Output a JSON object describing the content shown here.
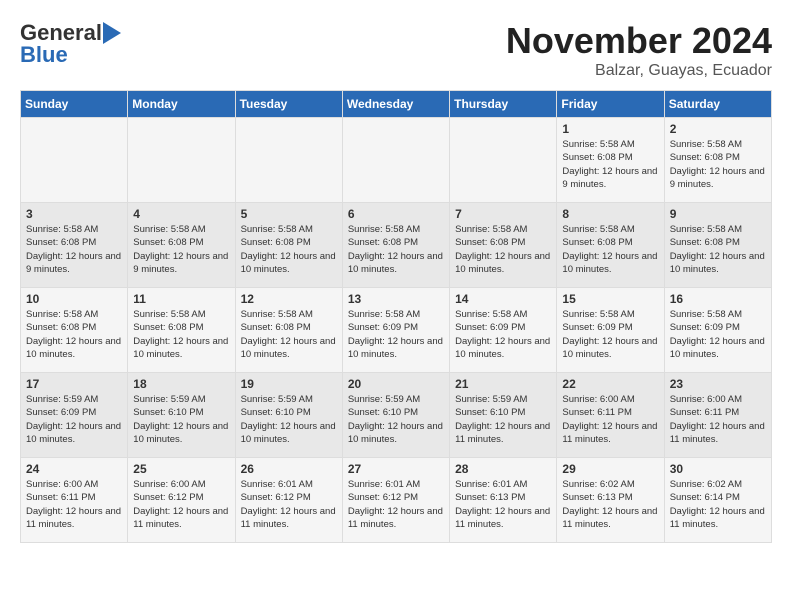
{
  "header": {
    "logo_general": "General",
    "logo_blue": "Blue",
    "month_title": "November 2024",
    "location": "Balzar, Guayas, Ecuador"
  },
  "weekdays": [
    "Sunday",
    "Monday",
    "Tuesday",
    "Wednesday",
    "Thursday",
    "Friday",
    "Saturday"
  ],
  "weeks": [
    [
      {
        "day": "",
        "info": ""
      },
      {
        "day": "",
        "info": ""
      },
      {
        "day": "",
        "info": ""
      },
      {
        "day": "",
        "info": ""
      },
      {
        "day": "",
        "info": ""
      },
      {
        "day": "1",
        "info": "Sunrise: 5:58 AM\nSunset: 6:08 PM\nDaylight: 12 hours and 9 minutes."
      },
      {
        "day": "2",
        "info": "Sunrise: 5:58 AM\nSunset: 6:08 PM\nDaylight: 12 hours and 9 minutes."
      }
    ],
    [
      {
        "day": "3",
        "info": "Sunrise: 5:58 AM\nSunset: 6:08 PM\nDaylight: 12 hours and 9 minutes."
      },
      {
        "day": "4",
        "info": "Sunrise: 5:58 AM\nSunset: 6:08 PM\nDaylight: 12 hours and 9 minutes."
      },
      {
        "day": "5",
        "info": "Sunrise: 5:58 AM\nSunset: 6:08 PM\nDaylight: 12 hours and 10 minutes."
      },
      {
        "day": "6",
        "info": "Sunrise: 5:58 AM\nSunset: 6:08 PM\nDaylight: 12 hours and 10 minutes."
      },
      {
        "day": "7",
        "info": "Sunrise: 5:58 AM\nSunset: 6:08 PM\nDaylight: 12 hours and 10 minutes."
      },
      {
        "day": "8",
        "info": "Sunrise: 5:58 AM\nSunset: 6:08 PM\nDaylight: 12 hours and 10 minutes."
      },
      {
        "day": "9",
        "info": "Sunrise: 5:58 AM\nSunset: 6:08 PM\nDaylight: 12 hours and 10 minutes."
      }
    ],
    [
      {
        "day": "10",
        "info": "Sunrise: 5:58 AM\nSunset: 6:08 PM\nDaylight: 12 hours and 10 minutes."
      },
      {
        "day": "11",
        "info": "Sunrise: 5:58 AM\nSunset: 6:08 PM\nDaylight: 12 hours and 10 minutes."
      },
      {
        "day": "12",
        "info": "Sunrise: 5:58 AM\nSunset: 6:08 PM\nDaylight: 12 hours and 10 minutes."
      },
      {
        "day": "13",
        "info": "Sunrise: 5:58 AM\nSunset: 6:09 PM\nDaylight: 12 hours and 10 minutes."
      },
      {
        "day": "14",
        "info": "Sunrise: 5:58 AM\nSunset: 6:09 PM\nDaylight: 12 hours and 10 minutes."
      },
      {
        "day": "15",
        "info": "Sunrise: 5:58 AM\nSunset: 6:09 PM\nDaylight: 12 hours and 10 minutes."
      },
      {
        "day": "16",
        "info": "Sunrise: 5:58 AM\nSunset: 6:09 PM\nDaylight: 12 hours and 10 minutes."
      }
    ],
    [
      {
        "day": "17",
        "info": "Sunrise: 5:59 AM\nSunset: 6:09 PM\nDaylight: 12 hours and 10 minutes."
      },
      {
        "day": "18",
        "info": "Sunrise: 5:59 AM\nSunset: 6:10 PM\nDaylight: 12 hours and 10 minutes."
      },
      {
        "day": "19",
        "info": "Sunrise: 5:59 AM\nSunset: 6:10 PM\nDaylight: 12 hours and 10 minutes."
      },
      {
        "day": "20",
        "info": "Sunrise: 5:59 AM\nSunset: 6:10 PM\nDaylight: 12 hours and 10 minutes."
      },
      {
        "day": "21",
        "info": "Sunrise: 5:59 AM\nSunset: 6:10 PM\nDaylight: 12 hours and 11 minutes."
      },
      {
        "day": "22",
        "info": "Sunrise: 6:00 AM\nSunset: 6:11 PM\nDaylight: 12 hours and 11 minutes."
      },
      {
        "day": "23",
        "info": "Sunrise: 6:00 AM\nSunset: 6:11 PM\nDaylight: 12 hours and 11 minutes."
      }
    ],
    [
      {
        "day": "24",
        "info": "Sunrise: 6:00 AM\nSunset: 6:11 PM\nDaylight: 12 hours and 11 minutes."
      },
      {
        "day": "25",
        "info": "Sunrise: 6:00 AM\nSunset: 6:12 PM\nDaylight: 12 hours and 11 minutes."
      },
      {
        "day": "26",
        "info": "Sunrise: 6:01 AM\nSunset: 6:12 PM\nDaylight: 12 hours and 11 minutes."
      },
      {
        "day": "27",
        "info": "Sunrise: 6:01 AM\nSunset: 6:12 PM\nDaylight: 12 hours and 11 minutes."
      },
      {
        "day": "28",
        "info": "Sunrise: 6:01 AM\nSunset: 6:13 PM\nDaylight: 12 hours and 11 minutes."
      },
      {
        "day": "29",
        "info": "Sunrise: 6:02 AM\nSunset: 6:13 PM\nDaylight: 12 hours and 11 minutes."
      },
      {
        "day": "30",
        "info": "Sunrise: 6:02 AM\nSunset: 6:14 PM\nDaylight: 12 hours and 11 minutes."
      }
    ]
  ]
}
